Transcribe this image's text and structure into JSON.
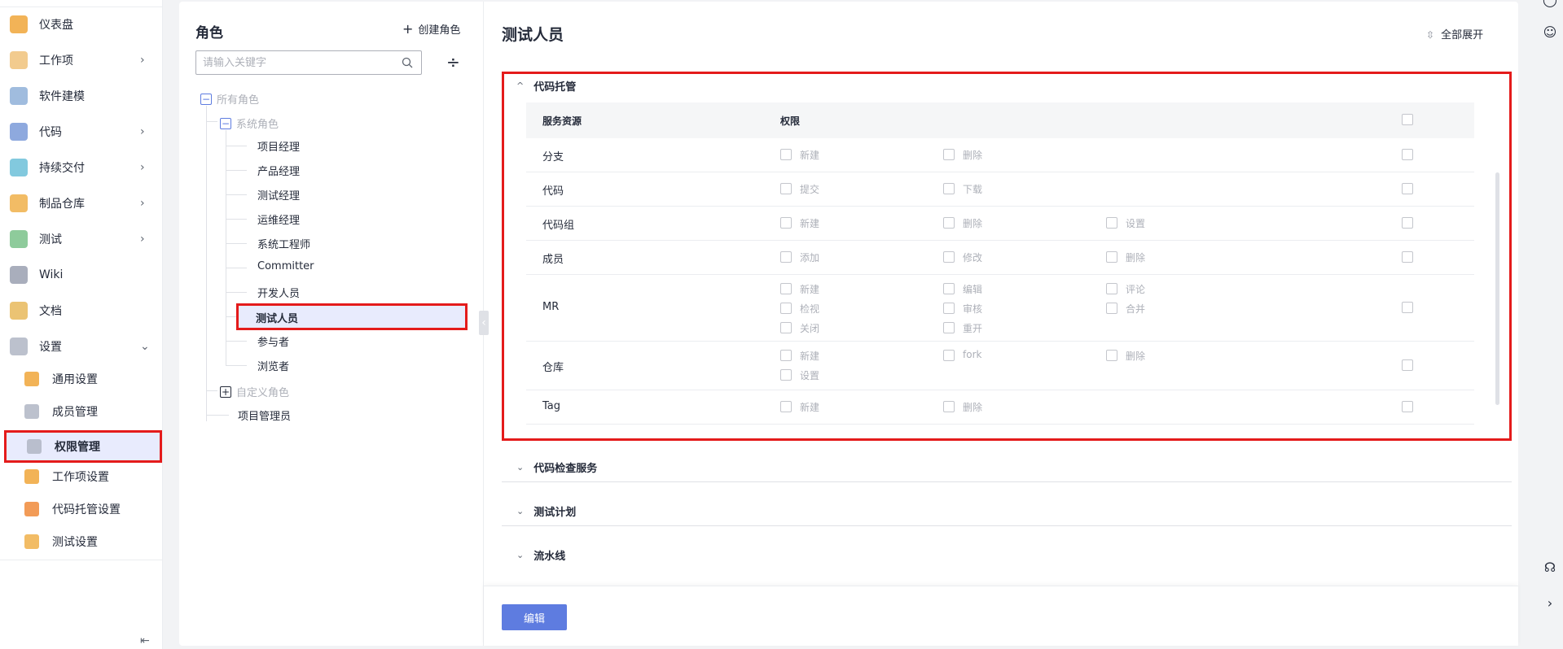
{
  "nav": {
    "items": [
      {
        "label": "仪表盘",
        "icon": "dashboard-icon",
        "color": "#f0a63a",
        "chevron": ""
      },
      {
        "label": "工作项",
        "icon": "workitem-icon",
        "color": "#f0c27a",
        "chevron": "›"
      },
      {
        "label": "软件建模",
        "icon": "modeling-icon",
        "color": "#8fb0d8",
        "chevron": ""
      },
      {
        "label": "代码",
        "icon": "code-icon",
        "color": "#7a9ad8",
        "chevron": "›"
      },
      {
        "label": "持续交付",
        "icon": "delivery-icon",
        "color": "#6cc0d8",
        "chevron": "›"
      },
      {
        "label": "制品仓库",
        "icon": "artifact-icon",
        "color": "#f0b04a",
        "chevron": "›"
      },
      {
        "label": "测试",
        "icon": "test-icon",
        "color": "#7ac28a",
        "chevron": "›"
      },
      {
        "label": "Wiki",
        "icon": "wiki-icon",
        "color": "#9aa0b0",
        "chevron": ""
      },
      {
        "label": "文档",
        "icon": "doc-icon",
        "color": "#e8b85a",
        "chevron": ""
      },
      {
        "label": "设置",
        "icon": "settings-icon",
        "color": "#b0b6c4",
        "chevron": "⌄"
      }
    ],
    "sub_items": [
      {
        "label": "通用设置",
        "icon": "general-settings-icon",
        "color": "#f0a63a"
      },
      {
        "label": "成员管理",
        "icon": "member-manage-icon",
        "color": "#b0b6c4"
      },
      {
        "label": "权限管理",
        "icon": "permission-manage-icon",
        "color": "#b0b6c4"
      },
      {
        "label": "工作项设置",
        "icon": "workitem-settings-icon",
        "color": "#f0a63a"
      },
      {
        "label": "代码托管设置",
        "icon": "code-hosting-settings-icon",
        "color": "#f08a3a"
      },
      {
        "label": "测试设置",
        "icon": "test-settings-icon",
        "color": "#f0b04a"
      }
    ]
  },
  "roles": {
    "title": "角色",
    "create_label": "创建角色",
    "search_placeholder": "请输入关键字",
    "root": "所有角色",
    "system": "系统角色",
    "system_roles": [
      "项目经理",
      "产品经理",
      "测试经理",
      "运维经理",
      "系统工程师",
      "Committer",
      "开发人员",
      "测试人员",
      "参与者",
      "浏览者"
    ],
    "selected": "测试人员",
    "custom": "自定义角色",
    "project_admin": "项目管理员"
  },
  "perm": {
    "title": "测试人员",
    "expand_all": "全部展开",
    "header_resource": "服务资源",
    "header_permission": "权限",
    "sections": [
      "代码托管",
      "代码检查服务",
      "测试计划",
      "流水线"
    ],
    "rows": [
      {
        "name": "分支",
        "perms": [
          "新建",
          "删除"
        ]
      },
      {
        "name": "代码",
        "perms": [
          "提交",
          "下载"
        ]
      },
      {
        "name": "代码组",
        "perms": [
          "新建",
          "删除",
          "设置"
        ]
      },
      {
        "name": "成员",
        "perms": [
          "添加",
          "修改",
          "删除"
        ]
      },
      {
        "name": "MR",
        "perms": [
          "新建",
          "编辑",
          "评论",
          "检视",
          "审核",
          "合并",
          "关闭",
          "重开"
        ]
      },
      {
        "name": "仓库",
        "perms": [
          "新建",
          "fork",
          "删除",
          "设置"
        ]
      },
      {
        "name": "Tag",
        "perms": [
          "新建",
          "删除"
        ]
      }
    ],
    "edit_label": "编辑"
  }
}
